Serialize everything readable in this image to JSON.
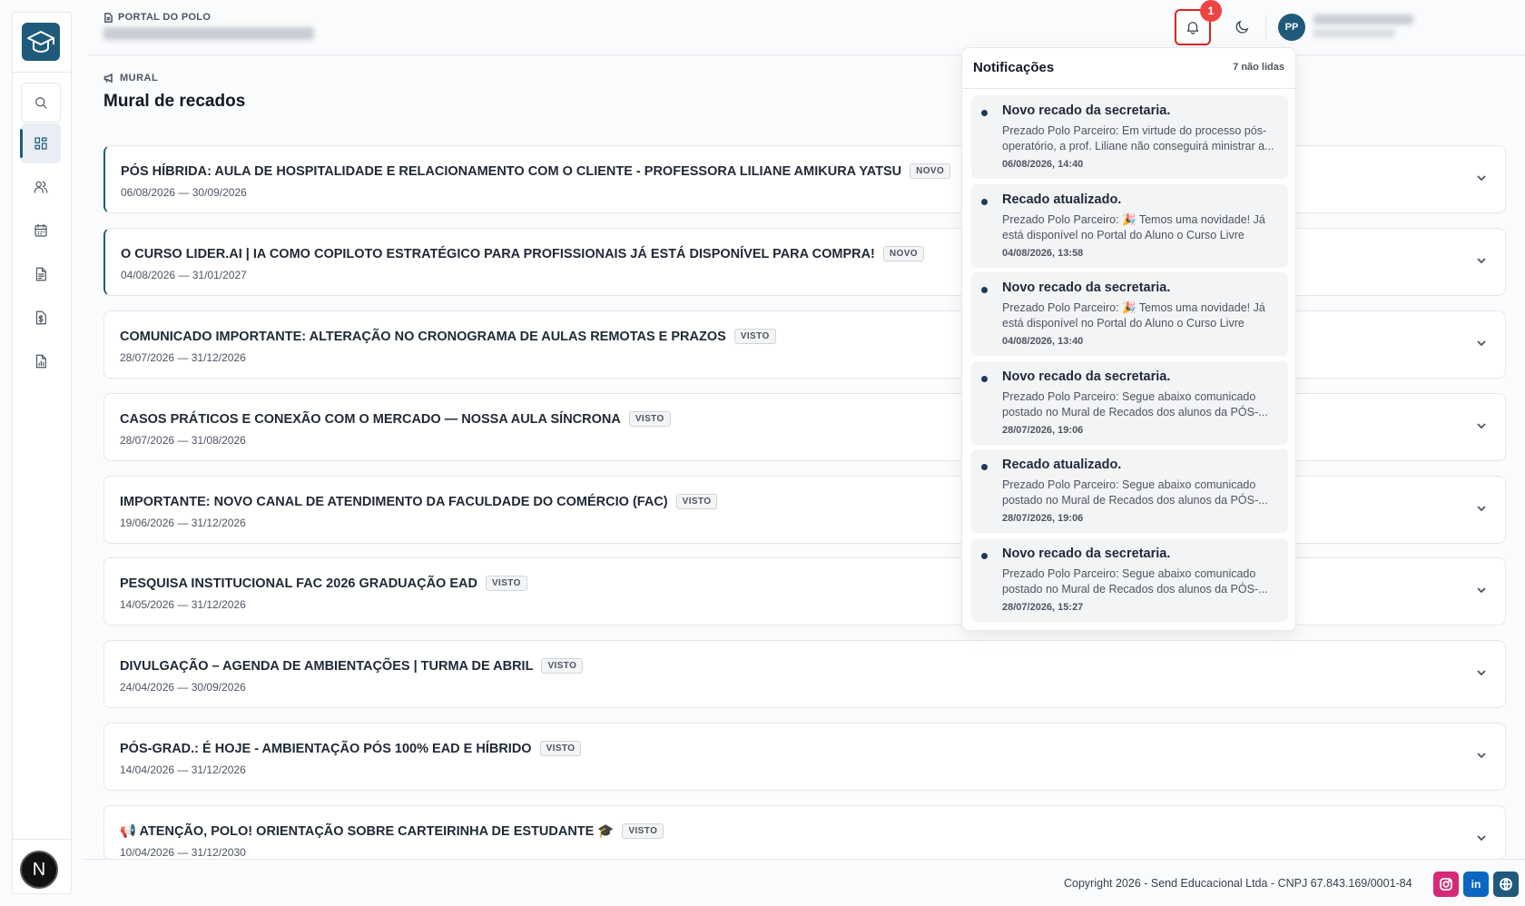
{
  "header": {
    "portal_label": "PORTAL DO POLO",
    "avatar_initials": "PP",
    "notification_count": "1"
  },
  "sidebar": {
    "items": [
      "search",
      "dashboard",
      "users",
      "calendar",
      "documents",
      "finance",
      "reports"
    ],
    "bottom_badge": "N"
  },
  "main": {
    "section_label": "MURAL",
    "title": "Mural de recados",
    "notices": [
      {
        "title": "PÓS HÍBRIDA: AULA DE HOSPITALIDADE E RELACIONAMENTO COM O CLIENTE - PROFESSORA LILIANE AMIKURA YATSU",
        "tag": "NOVO",
        "dates": "06/08/2026 — 30/09/2026"
      },
      {
        "title": "O CURSO LIDER.AI | IA COMO COPILOTO ESTRATÉGICO PARA PROFISSIONAIS JÁ ESTÁ DISPONÍVEL PARA COMPRA!",
        "tag": "NOVO",
        "dates": "04/08/2026 — 31/01/2027"
      },
      {
        "title": "COMUNICADO IMPORTANTE: ALTERAÇÃO NO CRONOGRAMA DE AULAS REMOTAS E PRAZOS",
        "tag": "VISTO",
        "dates": "28/07/2026 — 31/12/2026"
      },
      {
        "title": "CASOS PRÁTICOS E CONEXÃO COM O MERCADO — NOSSA AULA SÍNCRONA",
        "tag": "VISTO",
        "dates": "28/07/2026 — 31/08/2026"
      },
      {
        "title": "IMPORTANTE: NOVO CANAL DE ATENDIMENTO DA FACULDADE DO COMÉRCIO (FAC)",
        "tag": "VISTO",
        "dates": "19/06/2026 — 31/12/2026"
      },
      {
        "title": "PESQUISA INSTITUCIONAL FAC 2026 GRADUAÇÃO EAD",
        "tag": "VISTO",
        "dates": "14/05/2026 — 31/12/2026"
      },
      {
        "title": "DIVULGAÇÃO – AGENDA DE AMBIENTAÇÕES | TURMA DE ABRIL",
        "tag": "VISTO",
        "dates": "24/04/2026 — 30/09/2026"
      },
      {
        "title": "PÓS-GRAD.: É HOJE - AMBIENTAÇÃO PÓS 100% EAD E HÍBRIDO",
        "tag": "VISTO",
        "dates": "14/04/2026 — 31/12/2026"
      },
      {
        "title": "📢 ATENÇÃO, POLO! ORIENTAÇÃO SOBRE CARTEIRINHA DE ESTUDANTE 🎓",
        "tag": "VISTO",
        "dates": "10/04/2026 — 31/12/2030"
      }
    ]
  },
  "notifications": {
    "title": "Notificações",
    "unread_label": "7 não lidas",
    "items": [
      {
        "title": "Novo recado da secretaria.",
        "body": "Prezado Polo Parceiro: Em virtude do processo pós-operatório, a prof. Liliane não conseguirá ministrar a...",
        "time": "06/08/2026, 14:40"
      },
      {
        "title": "Recado atualizado.",
        "body": "Prezado Polo Parceiro: 🎉 Temos uma novidade! Já está disponível no Portal do Aluno o Curso Livre Lider....",
        "time": "04/08/2026, 13:58"
      },
      {
        "title": "Novo recado da secretaria.",
        "body": "Prezado Polo Parceiro: 🎉 Temos uma novidade! Já está disponível no Portal do Aluno o Curso Livre Lider....",
        "time": "04/08/2026, 13:40"
      },
      {
        "title": "Novo recado da secretaria.",
        "body": "Prezado Polo Parceiro: Segue abaixo comunicado postado no Mural de Recados dos alunos da PÓS-...",
        "time": "28/07/2026, 19:06"
      },
      {
        "title": "Recado atualizado.",
        "body": "Prezado Polo Parceiro: Segue abaixo comunicado postado no Mural de Recados dos alunos da PÓS-...",
        "time": "28/07/2026, 19:06"
      },
      {
        "title": "Novo recado da secretaria.",
        "body": "Prezado Polo Parceiro: Segue abaixo comunicado postado no Mural de Recados dos alunos da PÓS-...",
        "time": "28/07/2026, 15:27"
      }
    ]
  },
  "footer": {
    "copyright": "Copyright 2026 - Send Educacional Ltda - CNPJ 67.843.169/0001-84",
    "social": [
      "instagram-icon",
      "linkedin-icon",
      "globe-icon"
    ]
  },
  "colors": {
    "brand": "#1f5a7a",
    "alert": "#ef4444",
    "instagram": "#d62976",
    "linkedin": "#0a66c2"
  }
}
